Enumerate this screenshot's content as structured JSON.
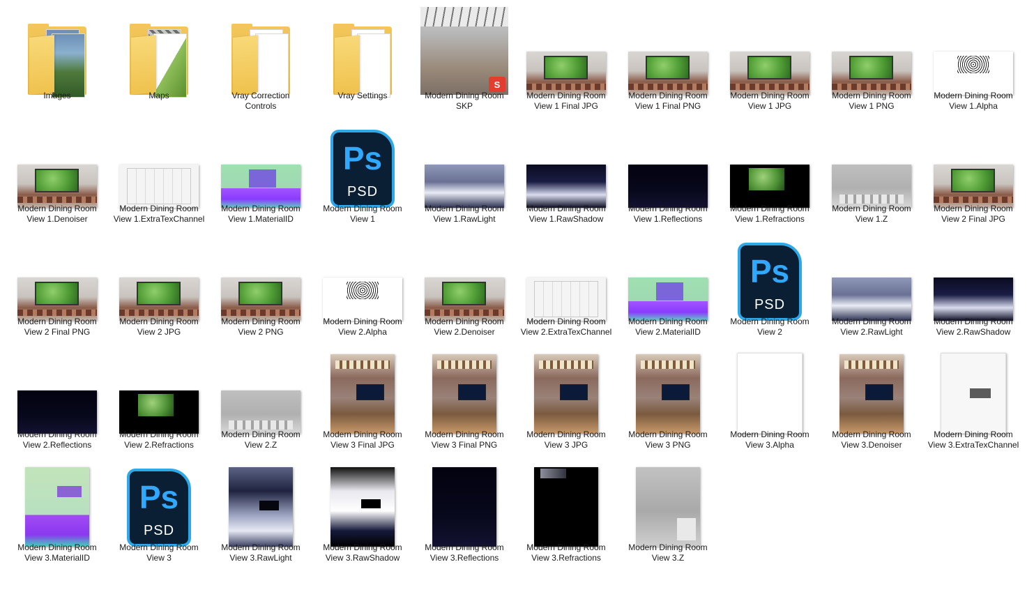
{
  "explorer": {
    "items": [
      {
        "label": "Images",
        "kind": "folder",
        "paper": "photo"
      },
      {
        "label": "Maps",
        "kind": "folder",
        "paper": "gray"
      },
      {
        "label": "Vray Correction\nControls",
        "kind": "folder",
        "paper": "blank"
      },
      {
        "label": "Vray Settings",
        "kind": "folder",
        "paper": "blank"
      },
      {
        "label": "Modern Dining Room\nSKP",
        "kind": "skp"
      },
      {
        "label": "Modern Dining Room\nView 1 Final JPG",
        "kind": "image",
        "orient": "landscape",
        "style": "render"
      },
      {
        "label": "Modern Dining Room\nView 1 Final PNG",
        "kind": "image",
        "orient": "landscape",
        "style": "render"
      },
      {
        "label": "Modern Dining Room\nView 1 JPG",
        "kind": "image",
        "orient": "landscape",
        "style": "render"
      },
      {
        "label": "Modern Dining Room\nView 1 PNG",
        "kind": "image",
        "orient": "landscape",
        "style": "render"
      },
      {
        "label": "Modern Dining Room\nView 1.Alpha",
        "kind": "image",
        "orient": "landscape",
        "style": "alpha"
      },
      {
        "label": "Modern Dining Room\nView 1.Denoiser",
        "kind": "image",
        "orient": "landscape",
        "style": "render"
      },
      {
        "label": "Modern Dining Room\nView 1.ExtraTexChannel",
        "kind": "image",
        "orient": "landscape",
        "style": "wire"
      },
      {
        "label": "Modern Dining Room\nView 1.MaterialID",
        "kind": "image",
        "orient": "landscape",
        "style": "matid"
      },
      {
        "label": "Modern Dining Room\nView 1",
        "kind": "psd"
      },
      {
        "label": "Modern Dining Room\nView 1.RawLight",
        "kind": "image",
        "orient": "landscape",
        "style": "rawlight"
      },
      {
        "label": "Modern Dining Room\nView 1.RawShadow",
        "kind": "image",
        "orient": "landscape",
        "style": "rawshadow"
      },
      {
        "label": "Modern Dining Room\nView 1.Reflections",
        "kind": "image",
        "orient": "landscape",
        "style": "reflect"
      },
      {
        "label": "Modern Dining Room\nView 1.Refractions",
        "kind": "image",
        "orient": "landscape",
        "style": "refract"
      },
      {
        "label": "Modern Dining Room\nView 1.Z",
        "kind": "image",
        "orient": "landscape",
        "style": "z"
      },
      {
        "label": "Modern Dining Room\nView 2 Final JPG",
        "kind": "image",
        "orient": "landscape",
        "style": "render"
      },
      {
        "label": "Modern Dining Room\nView 2 Final PNG",
        "kind": "image",
        "orient": "landscape",
        "style": "render"
      },
      {
        "label": "Modern Dining Room\nView 2 JPG",
        "kind": "image",
        "orient": "landscape",
        "style": "render"
      },
      {
        "label": "Modern Dining Room\nView 2 PNG",
        "kind": "image",
        "orient": "landscape",
        "style": "render"
      },
      {
        "label": "Modern Dining Room\nView 2.Alpha",
        "kind": "image",
        "orient": "landscape",
        "style": "alpha"
      },
      {
        "label": "Modern Dining Room\nView 2.Denoiser",
        "kind": "image",
        "orient": "landscape",
        "style": "render"
      },
      {
        "label": "Modern Dining Room\nView 2.ExtraTexChannel",
        "kind": "image",
        "orient": "landscape",
        "style": "wire"
      },
      {
        "label": "Modern Dining Room\nView 2.MaterialID",
        "kind": "image",
        "orient": "landscape",
        "style": "matid"
      },
      {
        "label": "Modern Dining Room\nView 2",
        "kind": "psd"
      },
      {
        "label": "Modern Dining Room\nView 2.RawLight",
        "kind": "image",
        "orient": "landscape",
        "style": "rawlight"
      },
      {
        "label": "Modern Dining Room\nView 2.RawShadow",
        "kind": "image",
        "orient": "landscape",
        "style": "rawshadow"
      },
      {
        "label": "Modern Dining Room\nView 2.Reflections",
        "kind": "image",
        "orient": "landscape",
        "style": "reflect"
      },
      {
        "label": "Modern Dining Room\nView 2.Refractions",
        "kind": "image",
        "orient": "landscape",
        "style": "refract"
      },
      {
        "label": "Modern Dining Room\nView 2.Z",
        "kind": "image",
        "orient": "landscape",
        "style": "z"
      },
      {
        "label": "Modern Dining Room\nView 3 Final JPG",
        "kind": "image",
        "orient": "portrait",
        "style": "view3"
      },
      {
        "label": "Modern Dining Room\nView 3 Final PNG",
        "kind": "image",
        "orient": "portrait",
        "style": "view3"
      },
      {
        "label": "Modern Dining Room\nView 3 JPG",
        "kind": "image",
        "orient": "portrait",
        "style": "view3"
      },
      {
        "label": "Modern Dining Room\nView 3 PNG",
        "kind": "image",
        "orient": "portrait",
        "style": "view3"
      },
      {
        "label": "Modern Dining Room\nView 3.Alpha",
        "kind": "image",
        "orient": "portrait",
        "style": "white"
      },
      {
        "label": "Modern Dining Room\nView 3.Denoiser",
        "kind": "image",
        "orient": "portrait",
        "style": "view3"
      },
      {
        "label": "Modern Dining Room\nView 3.ExtraTexChannel",
        "kind": "image",
        "orient": "portrait",
        "style": "wire-p"
      },
      {
        "label": "Modern Dining Room\nView 3.MaterialID",
        "kind": "image",
        "orient": "portrait",
        "style": "matid-p"
      },
      {
        "label": "Modern Dining Room\nView 3",
        "kind": "psd"
      },
      {
        "label": "Modern Dining Room\nView 3.RawLight",
        "kind": "image",
        "orient": "portrait",
        "style": "rawlight-p"
      },
      {
        "label": "Modern Dining Room\nView 3.RawShadow",
        "kind": "image",
        "orient": "portrait",
        "style": "rawshadow-p"
      },
      {
        "label": "Modern Dining Room\nView 3.Reflections",
        "kind": "image",
        "orient": "portrait",
        "style": "reflect"
      },
      {
        "label": "Modern Dining Room\nView 3.Refractions",
        "kind": "image",
        "orient": "portrait",
        "style": "refract-p"
      },
      {
        "label": "Modern Dining Room\nView 3.Z",
        "kind": "image",
        "orient": "portrait",
        "style": "z-p"
      }
    ],
    "psd": {
      "ps_text": "Ps",
      "ext_text": "PSD"
    },
    "skp": {
      "logo_text": "S"
    }
  }
}
